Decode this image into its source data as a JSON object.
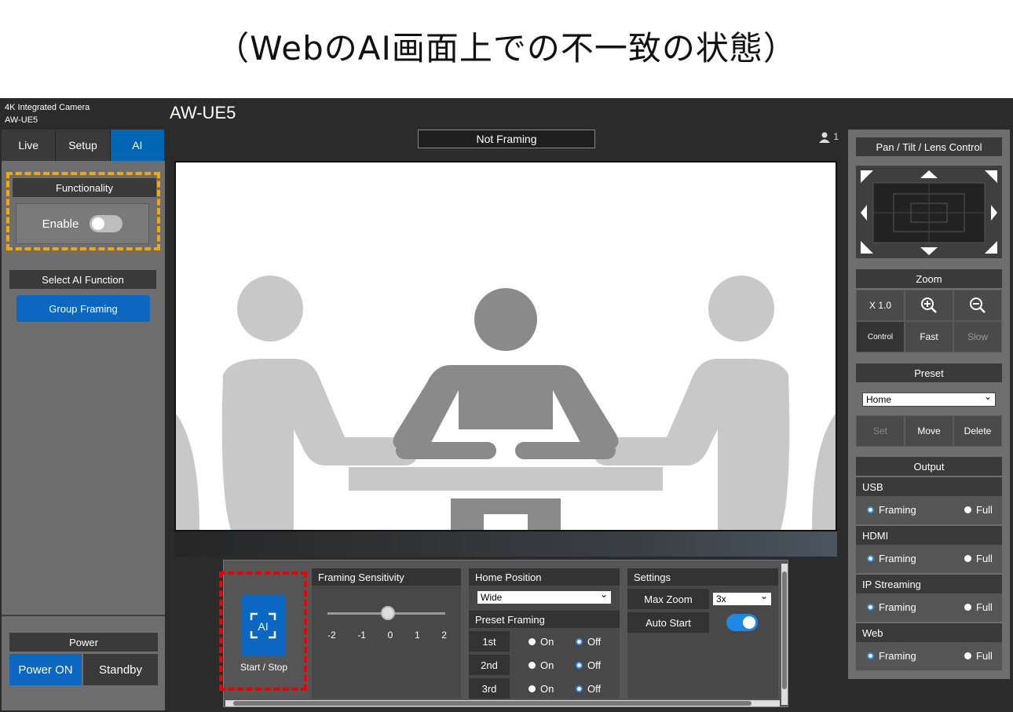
{
  "caption": "（WebのAI画面上での不一致の状態）",
  "header": {
    "model_line1": "4K Integrated Camera",
    "model_line2": "AW-UE5",
    "title": "AW-UE5"
  },
  "tabs": [
    {
      "label": "Live"
    },
    {
      "label": "Setup"
    },
    {
      "label": "AI"
    }
  ],
  "left": {
    "functionality_title": "Functionality",
    "enable_label": "Enable",
    "select_ai_title": "Select AI Function",
    "group_framing_label": "Group Framing",
    "power_title": "Power",
    "power_on_label": "Power ON",
    "standby_label": "Standby"
  },
  "status_text": "Not Framing",
  "user_count": "1",
  "controls": {
    "start_stop_label": "Start / Stop",
    "ai_icon_text": "AI",
    "framing_sensitivity_title": "Framing Sensitivity",
    "sensitivity_ticks": [
      "-2",
      "-1",
      "0",
      "1",
      "2"
    ],
    "sensitivity_value": 0,
    "home_position_title": "Home Position",
    "home_position_value": "Wide",
    "preset_framing_title": "Preset Framing",
    "preset_rows": [
      {
        "label": "1st",
        "on": "On",
        "off": "Off"
      },
      {
        "label": "2nd",
        "on": "On",
        "off": "Off"
      },
      {
        "label": "3rd",
        "on": "On",
        "off": "Off"
      }
    ],
    "settings_title": "Settings",
    "max_zoom_label": "Max Zoom",
    "max_zoom_value": "3x",
    "auto_start_label": "Auto Start"
  },
  "right": {
    "ptz_title": "Pan / Tilt / Lens Control",
    "zoom_title": "Zoom",
    "zoom_value": "X 1.0",
    "control_label": "Control",
    "fast_label": "Fast",
    "slow_label": "Slow",
    "preset_title": "Preset",
    "preset_value": "Home",
    "set_label": "Set",
    "move_label": "Move",
    "delete_label": "Delete",
    "output_title": "Output",
    "outputs": [
      {
        "name": "USB",
        "framing": "Framing",
        "full": "Full"
      },
      {
        "name": "HDMI",
        "framing": "Framing",
        "full": "Full"
      },
      {
        "name": "IP Streaming",
        "framing": "Framing",
        "full": "Full"
      },
      {
        "name": "Web",
        "framing": "Framing",
        "full": "Full"
      }
    ]
  },
  "colors": {
    "accent": "#0b67c2",
    "highlight_orange": "#f5a800",
    "highlight_red": "#e00000",
    "panel": "#6e6e6e",
    "dark": "#2b2b2b"
  }
}
